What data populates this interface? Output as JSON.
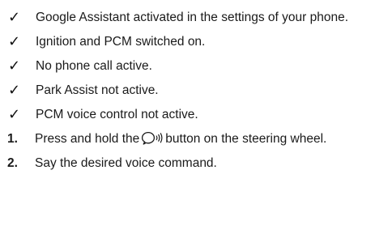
{
  "prerequisites": [
    {
      "mark": "✓",
      "text": "Google Assistant activated in the settings of your phone."
    },
    {
      "mark": "✓",
      "text": "Ignition and PCM switched on."
    },
    {
      "mark": "✓",
      "text": "No phone call active."
    },
    {
      "mark": "✓",
      "text": "Park Assist not active."
    },
    {
      "mark": "✓",
      "text": "PCM voice control not active."
    }
  ],
  "steps": [
    {
      "number": "1.",
      "text_before": "Press and hold the",
      "icon": "voice-control-icon",
      "text_after": "button on the steering wheel."
    },
    {
      "number": "2.",
      "text": "Say the desired voice command."
    }
  ]
}
